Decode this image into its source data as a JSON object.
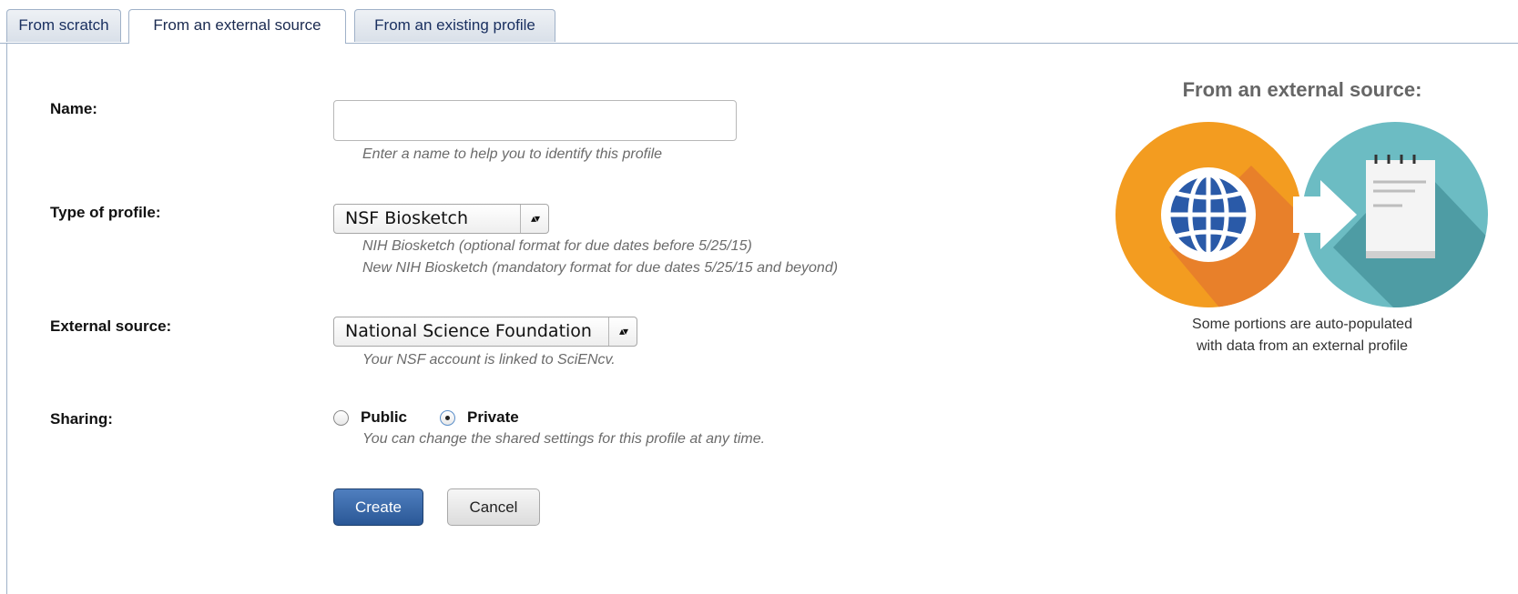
{
  "tabs": [
    {
      "label": "From scratch",
      "active": false
    },
    {
      "label": "From an external source",
      "active": true
    },
    {
      "label": "From an existing profile",
      "active": false
    }
  ],
  "form": {
    "name": {
      "label": "Name:",
      "value": "",
      "hint": "Enter a name to help you to identify this profile"
    },
    "type": {
      "label": "Type of profile:",
      "selected": "NSF Biosketch",
      "hint_lines": [
        "NIH Biosketch (optional format for due dates before 5/25/15)",
        "New NIH Biosketch (mandatory format for due dates 5/25/15 and beyond)"
      ]
    },
    "source": {
      "label": "External source:",
      "selected": "National Science Foundation",
      "hint": "Your NSF account is linked to SciENcv."
    },
    "sharing": {
      "label": "Sharing:",
      "options": [
        {
          "label": "Public",
          "checked": false
        },
        {
          "label": "Private",
          "checked": true
        }
      ],
      "hint": "You can change the shared settings for this profile at any time."
    },
    "create_label": "Create",
    "cancel_label": "Cancel"
  },
  "sidebar": {
    "title": "From an external source:",
    "caption_lines": [
      "Some portions are auto-populated",
      "with data from an external profile"
    ],
    "icons": [
      "globe-icon",
      "arrow-right-icon",
      "notepad-icon"
    ]
  },
  "colors": {
    "orange": "#F39C20",
    "orange_shadow": "#E8802A",
    "teal": "#6CBCC3",
    "teal_shadow": "#4E9CA4",
    "create_button": "#2A5796"
  }
}
